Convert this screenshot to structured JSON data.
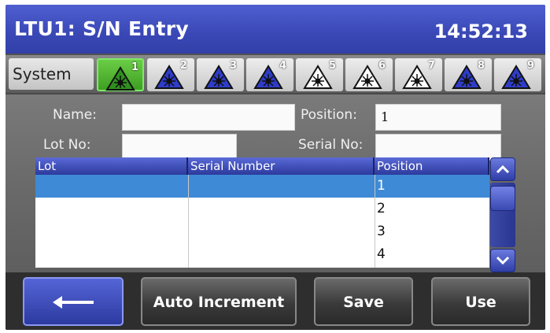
{
  "header": {
    "title": "LTU1: S/N Entry",
    "time": "14:52:13"
  },
  "tabs": {
    "system_label": "System",
    "lasers": [
      {
        "num": "1",
        "color": "#2f8f1e",
        "active": true
      },
      {
        "num": "2",
        "color": "#2e3cc8",
        "active": false
      },
      {
        "num": "3",
        "color": "#2e3cc8",
        "active": false
      },
      {
        "num": "4",
        "color": "#2e3cc8",
        "active": false
      },
      {
        "num": "5",
        "color": "#ffffff",
        "active": false
      },
      {
        "num": "6",
        "color": "#ffffff",
        "active": false
      },
      {
        "num": "7",
        "color": "#ffffff",
        "active": false
      },
      {
        "num": "8",
        "color": "#2e3cc8",
        "active": false
      },
      {
        "num": "9",
        "color": "#2e3cc8",
        "active": false
      }
    ]
  },
  "form": {
    "name_label": "Name:",
    "name_value": "",
    "position_label": "Position:",
    "position_value": "1",
    "lot_label": "Lot No:",
    "lot_value": "",
    "serial_label": "Serial No:",
    "serial_value": ""
  },
  "table": {
    "columns": [
      "Lot",
      "Serial Number",
      "Position"
    ],
    "rows": [
      {
        "lot": "",
        "serial": "",
        "position": "1",
        "selected": true
      },
      {
        "lot": "",
        "serial": "",
        "position": "2",
        "selected": false
      },
      {
        "lot": "",
        "serial": "",
        "position": "3",
        "selected": false
      },
      {
        "lot": "",
        "serial": "",
        "position": "4",
        "selected": false
      }
    ]
  },
  "buttons": {
    "back_icon": "left-arrow-icon",
    "auto_increment": "Auto Increment",
    "save": "Save",
    "use": "Use"
  }
}
